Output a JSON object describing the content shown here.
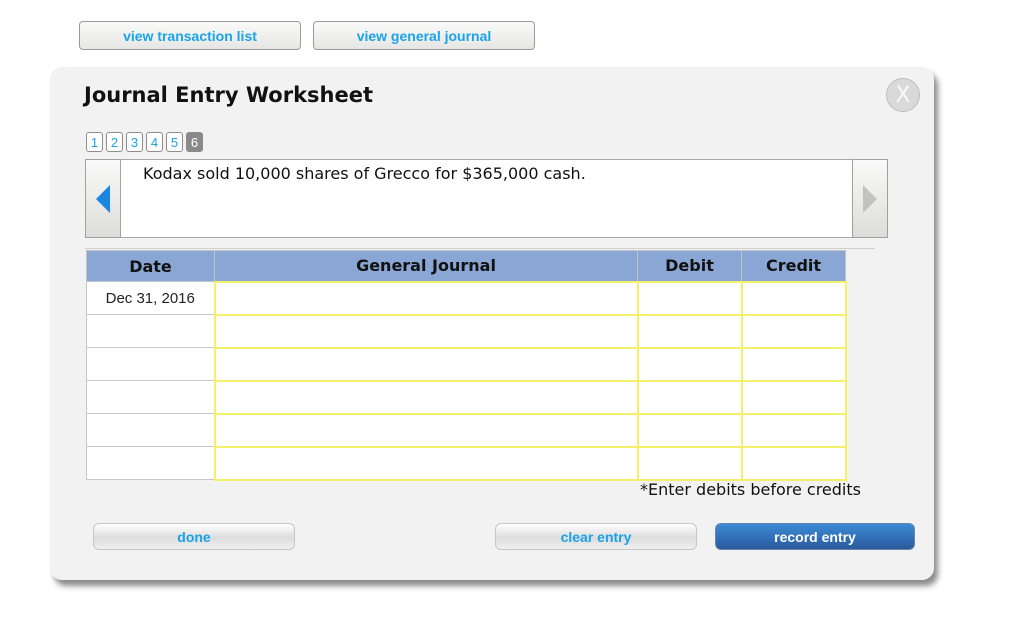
{
  "top_buttons": {
    "view_transaction_list": "view transaction list",
    "view_general_journal": "view general journal"
  },
  "dialog": {
    "title": "Journal Entry Worksheet",
    "close_label": "X",
    "pages": [
      "1",
      "2",
      "3",
      "4",
      "5",
      "6"
    ],
    "active_page": "6",
    "description": "Kodax sold 10,000 shares of Grecco for $365,000 cash.",
    "table": {
      "headers": [
        "Date",
        "General Journal",
        "Debit",
        "Credit"
      ],
      "rows": [
        {
          "date": "Dec 31, 2016",
          "account": "",
          "debit": "",
          "credit": ""
        },
        {
          "date": "",
          "account": "",
          "debit": "",
          "credit": ""
        },
        {
          "date": "",
          "account": "",
          "debit": "",
          "credit": ""
        },
        {
          "date": "",
          "account": "",
          "debit": "",
          "credit": ""
        },
        {
          "date": "",
          "account": "",
          "debit": "",
          "credit": ""
        },
        {
          "date": "",
          "account": "",
          "debit": "",
          "credit": ""
        }
      ]
    },
    "note": "*Enter debits before credits",
    "buttons": {
      "done": "done",
      "clear_entry": "clear entry",
      "record_entry": "record entry"
    }
  },
  "colors": {
    "link_blue": "#1aa3e8",
    "header_blue": "#8aa6d4",
    "input_border_yellow": "#f4f06a",
    "record_button": "#2a5a9c"
  }
}
